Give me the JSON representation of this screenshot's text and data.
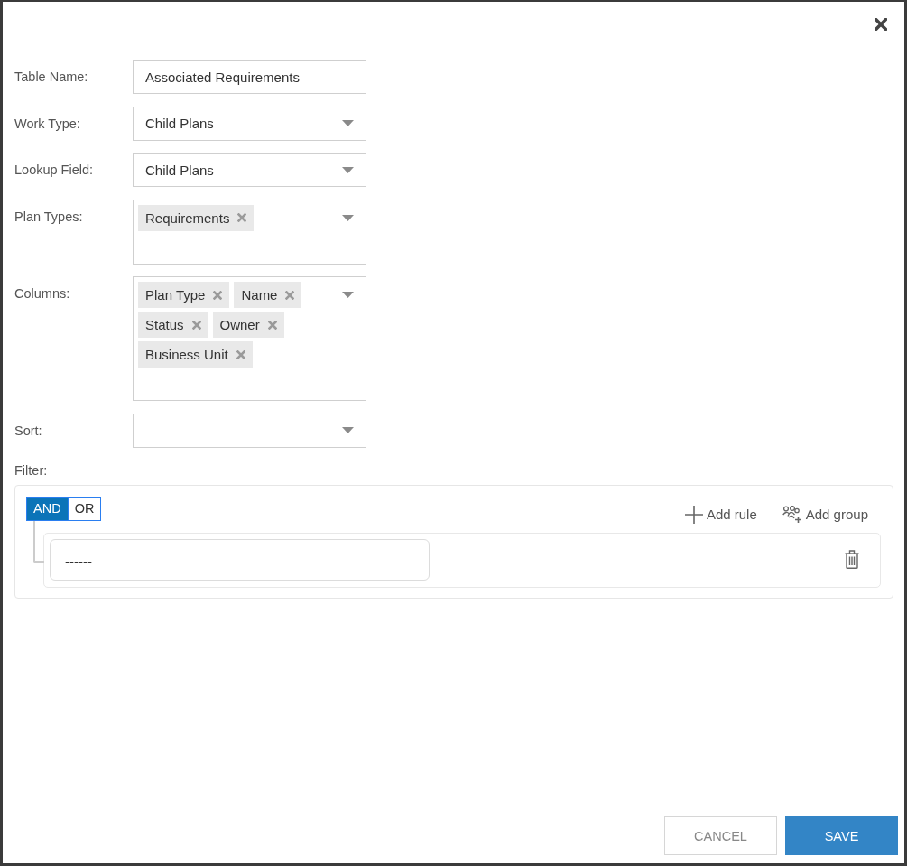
{
  "fields": [
    {
      "kind": "text",
      "label": "Table Name:",
      "value": "Associated Requirements"
    },
    {
      "kind": "select",
      "label": "Work Type:",
      "value": "Child Plans"
    },
    {
      "kind": "select",
      "label": "Lookup Field:",
      "value": "Child Plans"
    },
    {
      "kind": "multiselect",
      "label": "Plan Types:",
      "tags": [
        "Requirements"
      ]
    },
    {
      "kind": "multiselect",
      "label": "Columns:",
      "tags": [
        "Plan Type",
        "Name",
        "Status",
        "Owner",
        "Business Unit"
      ]
    },
    {
      "kind": "select",
      "label": "Sort:"
    }
  ],
  "filter": {
    "label": "Filter:",
    "conjunctions": [
      {
        "label": "AND",
        "selected": true
      },
      {
        "label": "OR",
        "selected": false
      }
    ],
    "actions": [
      {
        "kind": "rule",
        "label": "Add rule"
      },
      {
        "kind": "group",
        "label": "Add group"
      }
    ],
    "rules": [
      {
        "value": "------"
      }
    ]
  },
  "buttons": [
    {
      "kind": "secondary",
      "label": "CANCEL"
    },
    {
      "kind": "primary",
      "label": "SAVE"
    }
  ]
}
